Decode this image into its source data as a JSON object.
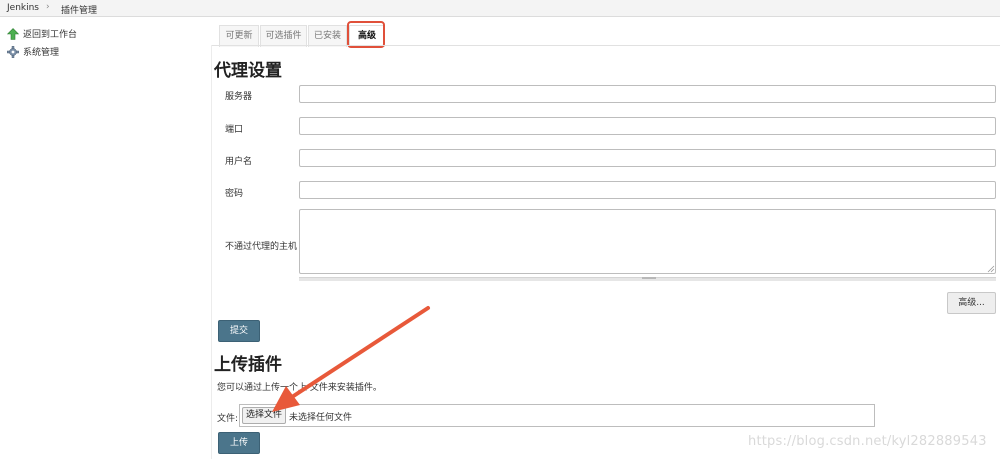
{
  "breadcrumb": {
    "items": [
      "Jenkins",
      "插件管理"
    ],
    "separator": "›"
  },
  "sidebar": {
    "items": [
      {
        "label": "返回到工作台",
        "icon": "arrow-up-icon"
      },
      {
        "label": "系统管理",
        "icon": "gear-icon"
      }
    ]
  },
  "tabs": [
    {
      "label": "可更新",
      "active": false
    },
    {
      "label": "可选插件",
      "active": false
    },
    {
      "label": "已安装",
      "active": false
    },
    {
      "label": "高级",
      "active": true
    }
  ],
  "proxy": {
    "title": "代理设置",
    "fields": [
      {
        "label": "服务器",
        "value": ""
      },
      {
        "label": "端口",
        "value": ""
      },
      {
        "label": "用户名",
        "value": ""
      },
      {
        "label": "密码",
        "value": ""
      }
    ],
    "no_proxy_label": "不通过代理的主机",
    "no_proxy_value": "",
    "advanced_button": "高级...",
    "submit_button": "提交"
  },
  "upload": {
    "title": "上传插件",
    "description": "您可以通过上传一个上    文件来安装插件。",
    "file_label": "文件:",
    "choose_button": "选择文件",
    "file_status": "未选择任何文件",
    "upload_button": "上传"
  },
  "watermark": "https://blog.csdn.net/kyl282889543",
  "colors": {
    "highlight": "#e0503a",
    "primary_button": "#4b758b",
    "arrow": "#e8593a"
  }
}
